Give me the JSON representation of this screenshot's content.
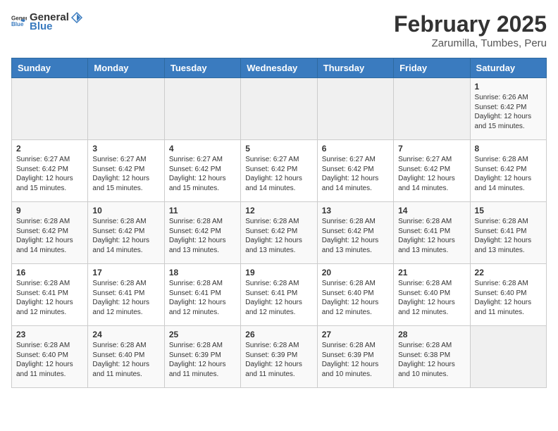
{
  "logo": {
    "general": "General",
    "blue": "Blue"
  },
  "title": "February 2025",
  "subtitle": "Zarumilla, Tumbes, Peru",
  "days_of_week": [
    "Sunday",
    "Monday",
    "Tuesday",
    "Wednesday",
    "Thursday",
    "Friday",
    "Saturday"
  ],
  "weeks": [
    [
      {
        "day": "",
        "info": ""
      },
      {
        "day": "",
        "info": ""
      },
      {
        "day": "",
        "info": ""
      },
      {
        "day": "",
        "info": ""
      },
      {
        "day": "",
        "info": ""
      },
      {
        "day": "",
        "info": ""
      },
      {
        "day": "1",
        "info": "Sunrise: 6:26 AM\nSunset: 6:42 PM\nDaylight: 12 hours and 15 minutes."
      }
    ],
    [
      {
        "day": "2",
        "info": "Sunrise: 6:27 AM\nSunset: 6:42 PM\nDaylight: 12 hours and 15 minutes."
      },
      {
        "day": "3",
        "info": "Sunrise: 6:27 AM\nSunset: 6:42 PM\nDaylight: 12 hours and 15 minutes."
      },
      {
        "day": "4",
        "info": "Sunrise: 6:27 AM\nSunset: 6:42 PM\nDaylight: 12 hours and 15 minutes."
      },
      {
        "day": "5",
        "info": "Sunrise: 6:27 AM\nSunset: 6:42 PM\nDaylight: 12 hours and 14 minutes."
      },
      {
        "day": "6",
        "info": "Sunrise: 6:27 AM\nSunset: 6:42 PM\nDaylight: 12 hours and 14 minutes."
      },
      {
        "day": "7",
        "info": "Sunrise: 6:27 AM\nSunset: 6:42 PM\nDaylight: 12 hours and 14 minutes."
      },
      {
        "day": "8",
        "info": "Sunrise: 6:28 AM\nSunset: 6:42 PM\nDaylight: 12 hours and 14 minutes."
      }
    ],
    [
      {
        "day": "9",
        "info": "Sunrise: 6:28 AM\nSunset: 6:42 PM\nDaylight: 12 hours and 14 minutes."
      },
      {
        "day": "10",
        "info": "Sunrise: 6:28 AM\nSunset: 6:42 PM\nDaylight: 12 hours and 14 minutes."
      },
      {
        "day": "11",
        "info": "Sunrise: 6:28 AM\nSunset: 6:42 PM\nDaylight: 12 hours and 13 minutes."
      },
      {
        "day": "12",
        "info": "Sunrise: 6:28 AM\nSunset: 6:42 PM\nDaylight: 12 hours and 13 minutes."
      },
      {
        "day": "13",
        "info": "Sunrise: 6:28 AM\nSunset: 6:42 PM\nDaylight: 12 hours and 13 minutes."
      },
      {
        "day": "14",
        "info": "Sunrise: 6:28 AM\nSunset: 6:41 PM\nDaylight: 12 hours and 13 minutes."
      },
      {
        "day": "15",
        "info": "Sunrise: 6:28 AM\nSunset: 6:41 PM\nDaylight: 12 hours and 13 minutes."
      }
    ],
    [
      {
        "day": "16",
        "info": "Sunrise: 6:28 AM\nSunset: 6:41 PM\nDaylight: 12 hours and 12 minutes."
      },
      {
        "day": "17",
        "info": "Sunrise: 6:28 AM\nSunset: 6:41 PM\nDaylight: 12 hours and 12 minutes."
      },
      {
        "day": "18",
        "info": "Sunrise: 6:28 AM\nSunset: 6:41 PM\nDaylight: 12 hours and 12 minutes."
      },
      {
        "day": "19",
        "info": "Sunrise: 6:28 AM\nSunset: 6:41 PM\nDaylight: 12 hours and 12 minutes."
      },
      {
        "day": "20",
        "info": "Sunrise: 6:28 AM\nSunset: 6:40 PM\nDaylight: 12 hours and 12 minutes."
      },
      {
        "day": "21",
        "info": "Sunrise: 6:28 AM\nSunset: 6:40 PM\nDaylight: 12 hours and 12 minutes."
      },
      {
        "day": "22",
        "info": "Sunrise: 6:28 AM\nSunset: 6:40 PM\nDaylight: 12 hours and 11 minutes."
      }
    ],
    [
      {
        "day": "23",
        "info": "Sunrise: 6:28 AM\nSunset: 6:40 PM\nDaylight: 12 hours and 11 minutes."
      },
      {
        "day": "24",
        "info": "Sunrise: 6:28 AM\nSunset: 6:40 PM\nDaylight: 12 hours and 11 minutes."
      },
      {
        "day": "25",
        "info": "Sunrise: 6:28 AM\nSunset: 6:39 PM\nDaylight: 12 hours and 11 minutes."
      },
      {
        "day": "26",
        "info": "Sunrise: 6:28 AM\nSunset: 6:39 PM\nDaylight: 12 hours and 11 minutes."
      },
      {
        "day": "27",
        "info": "Sunrise: 6:28 AM\nSunset: 6:39 PM\nDaylight: 12 hours and 10 minutes."
      },
      {
        "day": "28",
        "info": "Sunrise: 6:28 AM\nSunset: 6:38 PM\nDaylight: 12 hours and 10 minutes."
      },
      {
        "day": "",
        "info": ""
      }
    ]
  ]
}
